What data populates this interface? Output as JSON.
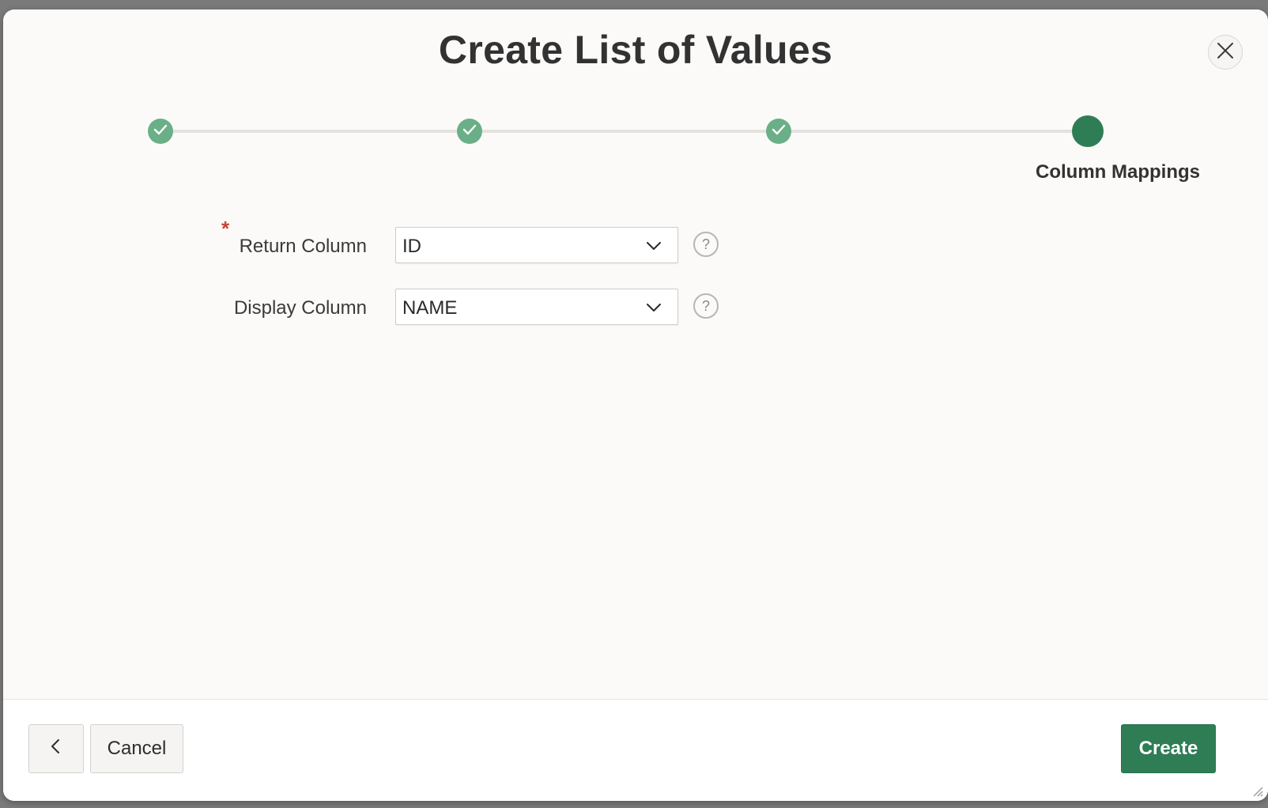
{
  "dialog": {
    "title": "Create List of Values",
    "close_icon": "close-icon"
  },
  "wizard": {
    "steps": [
      {
        "status": "completed",
        "icon": "check-icon"
      },
      {
        "status": "completed",
        "icon": "check-icon"
      },
      {
        "status": "completed",
        "icon": "check-icon"
      },
      {
        "status": "current",
        "label": "Column Mappings"
      }
    ],
    "colors": {
      "completed": "#6aaf88",
      "current": "#2e7d55",
      "track": "#e4e2df"
    }
  },
  "form": {
    "return_column": {
      "required_marker": "*",
      "label": "Return Column",
      "value": "ID",
      "help_icon": "?"
    },
    "display_column": {
      "label": "Display Column",
      "value": "NAME",
      "help_icon": "?"
    },
    "required_color": "#c74634"
  },
  "footer": {
    "previous_icon": "chevron-left-icon",
    "cancel_label": "Cancel",
    "create_label": "Create",
    "primary_color": "#2e7d55"
  }
}
